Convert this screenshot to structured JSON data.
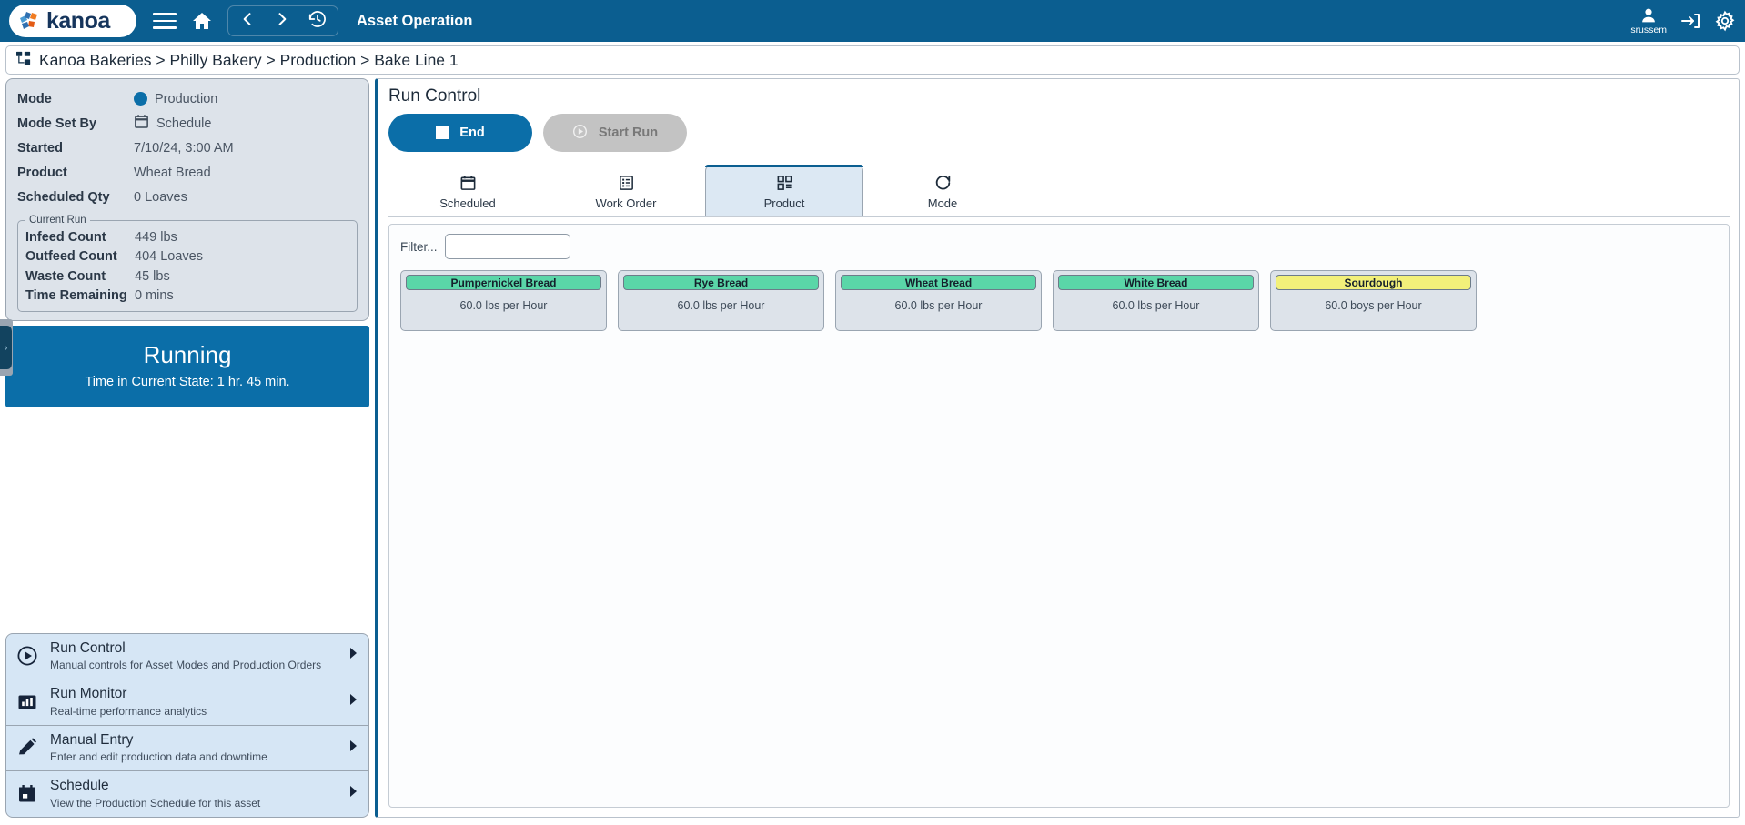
{
  "topbar": {
    "logo_text": "kanoa",
    "app_title": "Asset Operation",
    "username": "srussem",
    "icons": {
      "menu": "hamburger-icon",
      "home": "home-icon",
      "back": "chevron-left-icon",
      "forward": "chevron-right-icon",
      "history": "history-icon",
      "user": "user-icon",
      "login": "login-icon",
      "settings": "gear-icon"
    }
  },
  "breadcrumb": {
    "text": "Kanoa Bakeries > Philly Bakery > Production > Bake Line 1"
  },
  "asset_info": {
    "rows": [
      {
        "label": "Mode",
        "value": "Production"
      },
      {
        "label": "Mode Set By",
        "value": "Schedule"
      },
      {
        "label": "Started",
        "value": "7/10/24, 3:00 AM"
      },
      {
        "label": "Product",
        "value": "Wheat Bread"
      },
      {
        "label": "Scheduled Qty",
        "value": "0 Loaves"
      }
    ],
    "current_run": {
      "legend": "Current Run",
      "rows": [
        {
          "label": "Infeed Count",
          "value": "449 lbs"
        },
        {
          "label": "Outfeed Count",
          "value": "404 Loaves"
        },
        {
          "label": "Waste Count",
          "value": "45 lbs"
        },
        {
          "label": "Time Remaining",
          "value": "0 mins"
        }
      ]
    }
  },
  "state_card": {
    "title": "Running",
    "subtitle": "Time in Current State: 1 hr. 45 min."
  },
  "menu": {
    "items": [
      {
        "title": "Run Control",
        "desc": "Manual controls for Asset Modes and Production Orders",
        "icon": "play-circle-icon"
      },
      {
        "title": "Run Monitor",
        "desc": "Real-time performance analytics",
        "icon": "bar-chart-icon"
      },
      {
        "title": "Manual Entry",
        "desc": "Enter and edit production data and downtime",
        "icon": "pencil-icon"
      },
      {
        "title": "Schedule",
        "desc": "View the Production Schedule for this asset",
        "icon": "calendar-icon"
      }
    ]
  },
  "run_control": {
    "title": "Run Control",
    "end_label": "End",
    "start_label": "Start Run",
    "tabs": [
      {
        "label": "Scheduled",
        "icon": "calendar-icon",
        "active": false
      },
      {
        "label": "Work Order",
        "icon": "list-icon",
        "active": false
      },
      {
        "label": "Product",
        "icon": "qr-code-icon",
        "active": true
      },
      {
        "label": "Mode",
        "icon": "refresh-icon",
        "active": false
      }
    ],
    "filter_label": "Filter...",
    "filter_value": "",
    "products": [
      {
        "name": "Pumpernickel Bread",
        "rate": "60.0 lbs per Hour",
        "color": "#5ad6a8"
      },
      {
        "name": "Rye Bread",
        "rate": "60.0 lbs per Hour",
        "color": "#5ad6a8"
      },
      {
        "name": "Wheat Bread",
        "rate": "60.0 lbs per Hour",
        "color": "#5ad6a8"
      },
      {
        "name": "White Bread",
        "rate": "60.0 lbs per Hour",
        "color": "#5ad6a8"
      },
      {
        "name": "Sourdough",
        "rate": "60.0 boys per Hour",
        "color": "#f2f07a"
      }
    ]
  },
  "colors": {
    "brand_blue": "#0b5e90",
    "accent_blue": "#0b6ea8",
    "panel_grey": "#dde3ea",
    "menu_blue": "#d6e6f5"
  }
}
